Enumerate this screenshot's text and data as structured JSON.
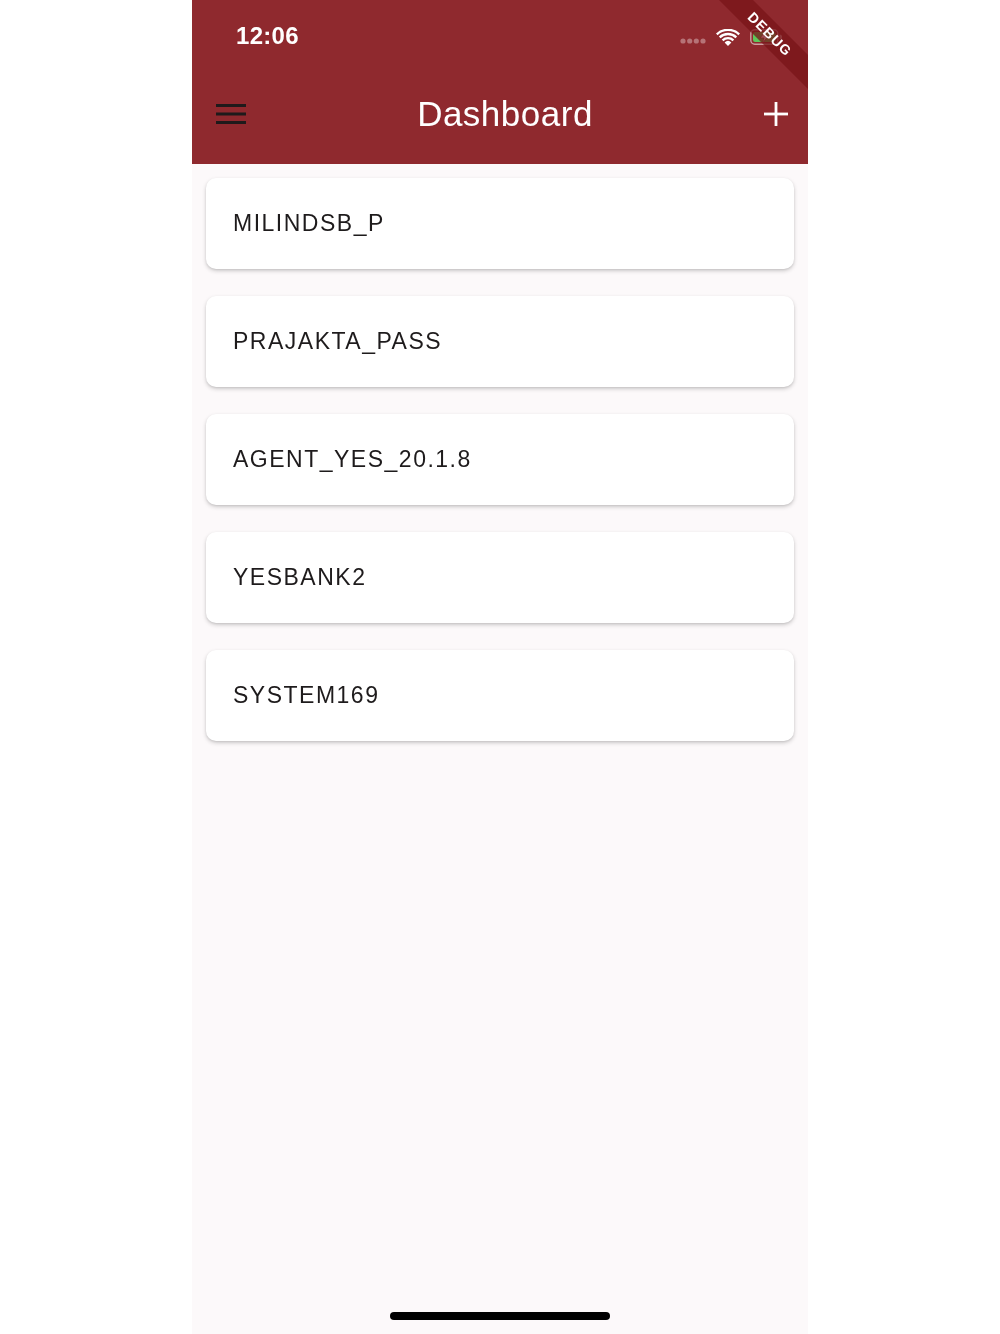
{
  "status_bar": {
    "time": "12:06"
  },
  "debug_banner": {
    "text": "DEBUG"
  },
  "app_bar": {
    "title": "Dashboard"
  },
  "items": [
    {
      "label": "MILINDSB_P"
    },
    {
      "label": "PRAJAKTA_PASS"
    },
    {
      "label": "AGENT_YES_20.1.8"
    },
    {
      "label": "YESBANK2"
    },
    {
      "label": "SYSTEM169"
    }
  ]
}
